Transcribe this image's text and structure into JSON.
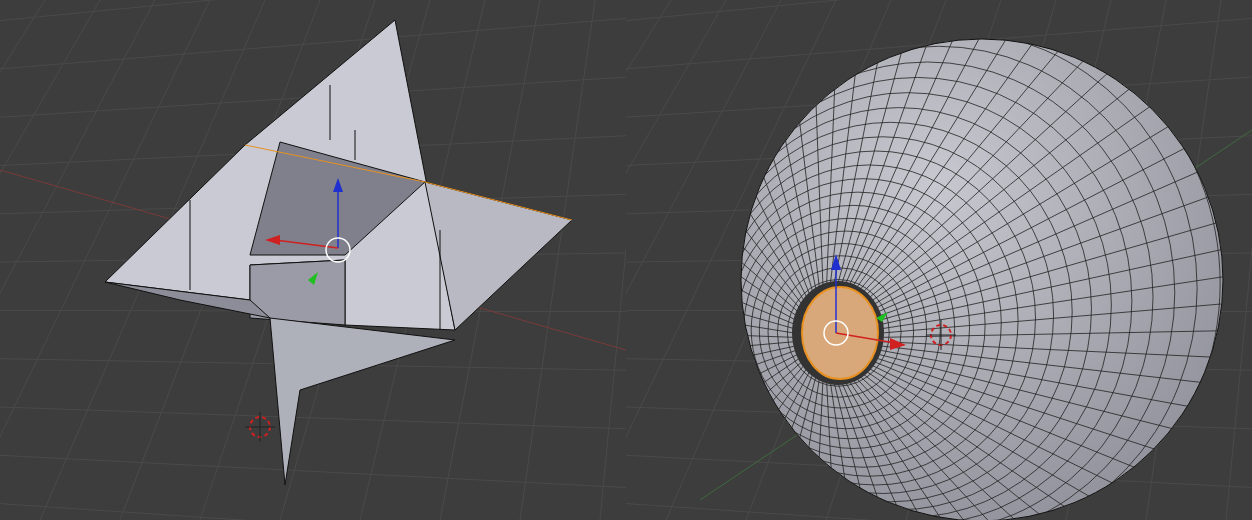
{
  "viewports": [
    {
      "kind": "star-mesh"
    },
    {
      "kind": "sphere-mesh"
    }
  ]
}
